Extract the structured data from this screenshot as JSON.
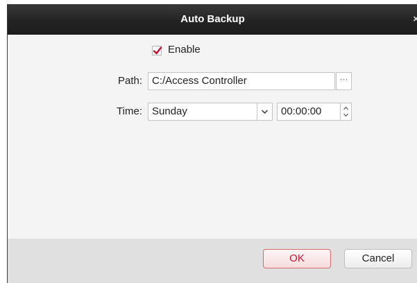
{
  "dialog": {
    "title": "Auto Backup",
    "close_glyph": "×"
  },
  "form": {
    "enable_label": "Enable",
    "enable_checked": true,
    "path_label": "Path:",
    "path_value": "C:/Access Controller",
    "browse_glyph": "···",
    "time_label": "Time:",
    "day_value": "Sunday",
    "time_value": "00:00:00"
  },
  "buttons": {
    "ok_label": "OK",
    "cancel_label": "Cancel"
  },
  "colors": {
    "titlebar": "#1c1c1c",
    "checkmark": "#c8102e",
    "ok_text": "#c8102e"
  },
  "icons": {
    "close": "close-icon",
    "check": "checkmark-icon",
    "browse": "ellipsis-icon",
    "dropdown": "chevron-down-icon",
    "spin_up": "caret-up-icon",
    "spin_down": "caret-down-icon"
  }
}
